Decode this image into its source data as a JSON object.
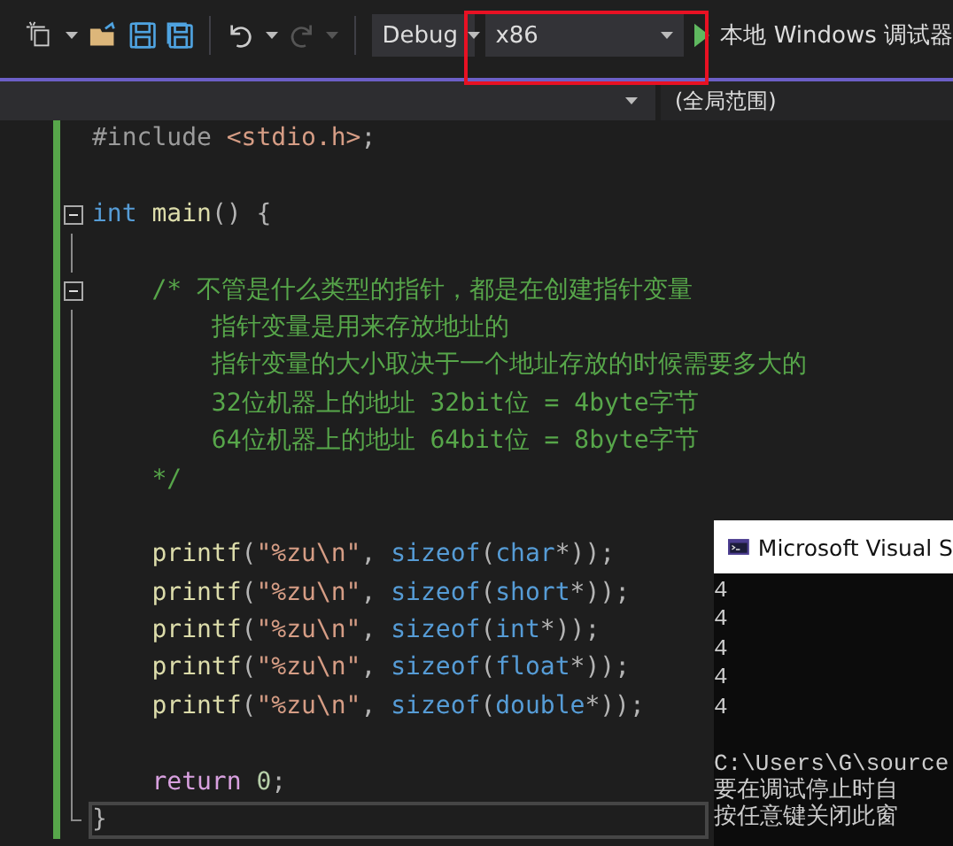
{
  "toolbar": {
    "redo_disabled": true,
    "configuration": "Debug",
    "platform": "x86",
    "platform_highlighted": true,
    "run_label": "本地 Windows 调试器"
  },
  "navigation_bar": {
    "scope": "(全局范围)"
  },
  "editor": {
    "lines": [
      {
        "current": false,
        "tokens": [
          {
            "kind": "preprocessor",
            "text": "#include "
          },
          {
            "kind": "string",
            "text": "<stdio.h>"
          },
          {
            "kind": "punct",
            "text": ";"
          }
        ]
      },
      {
        "current": false
      },
      {
        "current": false,
        "kind": "fold-start",
        "tokens": [
          {
            "kind": "keyword",
            "text": "int"
          },
          {
            "kind": "function",
            "text": " main"
          },
          {
            "kind": "punct",
            "text": "() {"
          }
        ]
      },
      {
        "current": false,
        "kind": "fold-inner"
      },
      {
        "current": false,
        "kind": "fold-start",
        "tokens": [
          {
            "kind": "comment",
            "text": "    /* 不管是什么类型的指针，都是在创建指针变量"
          }
        ]
      },
      {
        "current": false,
        "kind": "fold-inner",
        "tokens": [
          {
            "kind": "comment",
            "text": "        指针变量是用来存放地址的"
          }
        ]
      },
      {
        "current": false,
        "kind": "fold-inner",
        "tokens": [
          {
            "kind": "comment",
            "text": "        指针变量的大小取决于一个地址存放的时候需要多大的"
          }
        ]
      },
      {
        "current": false,
        "kind": "fold-inner",
        "tokens": [
          {
            "kind": "comment",
            "text": "        32位机器上的地址 32bit位 = 4byte字节"
          }
        ]
      },
      {
        "current": false,
        "kind": "fold-inner",
        "tokens": [
          {
            "kind": "comment",
            "text": "        64位机器上的地址 64bit位 = 8byte字节"
          }
        ]
      },
      {
        "current": false,
        "kind": "fold-inner",
        "tokens": [
          {
            "kind": "comment",
            "text": "    */"
          }
        ]
      },
      {
        "current": false,
        "kind": "fold-inner"
      },
      {
        "current": false,
        "kind": "fold-inner",
        "tokens": [
          {
            "kind": "function",
            "text": "    printf"
          },
          {
            "kind": "punct",
            "text": "("
          },
          {
            "kind": "string",
            "text": "\"%zu\\n\""
          },
          {
            "kind": "punct",
            "text": ", "
          },
          {
            "kind": "keyword",
            "text": "sizeof"
          },
          {
            "kind": "punct",
            "text": "("
          },
          {
            "kind": "keyword",
            "text": "char"
          },
          {
            "kind": "punct",
            "text": "*));"
          }
        ]
      },
      {
        "current": false,
        "kind": "fold-inner",
        "tokens": [
          {
            "kind": "function",
            "text": "    printf"
          },
          {
            "kind": "punct",
            "text": "("
          },
          {
            "kind": "string",
            "text": "\"%zu\\n\""
          },
          {
            "kind": "punct",
            "text": ", "
          },
          {
            "kind": "keyword",
            "text": "sizeof"
          },
          {
            "kind": "punct",
            "text": "("
          },
          {
            "kind": "keyword",
            "text": "short"
          },
          {
            "kind": "punct",
            "text": "*));"
          }
        ]
      },
      {
        "current": false,
        "kind": "fold-inner",
        "tokens": [
          {
            "kind": "function",
            "text": "    printf"
          },
          {
            "kind": "punct",
            "text": "("
          },
          {
            "kind": "string",
            "text": "\"%zu\\n\""
          },
          {
            "kind": "punct",
            "text": ", "
          },
          {
            "kind": "keyword",
            "text": "sizeof"
          },
          {
            "kind": "punct",
            "text": "("
          },
          {
            "kind": "keyword",
            "text": "int"
          },
          {
            "kind": "punct",
            "text": "*));"
          }
        ]
      },
      {
        "current": false,
        "kind": "fold-inner",
        "tokens": [
          {
            "kind": "function",
            "text": "    printf"
          },
          {
            "kind": "punct",
            "text": "("
          },
          {
            "kind": "string",
            "text": "\"%zu\\n\""
          },
          {
            "kind": "punct",
            "text": ", "
          },
          {
            "kind": "keyword",
            "text": "sizeof"
          },
          {
            "kind": "punct",
            "text": "("
          },
          {
            "kind": "keyword",
            "text": "float"
          },
          {
            "kind": "punct",
            "text": "*));"
          }
        ]
      },
      {
        "current": false,
        "kind": "fold-inner",
        "tokens": [
          {
            "kind": "function",
            "text": "    printf"
          },
          {
            "kind": "punct",
            "text": "("
          },
          {
            "kind": "string",
            "text": "\"%zu\\n\""
          },
          {
            "kind": "punct",
            "text": ", "
          },
          {
            "kind": "keyword",
            "text": "sizeof"
          },
          {
            "kind": "punct",
            "text": "("
          },
          {
            "kind": "keyword",
            "text": "double"
          },
          {
            "kind": "punct",
            "text": "*));"
          }
        ]
      },
      {
        "current": false,
        "kind": "fold-inner"
      },
      {
        "current": false,
        "kind": "fold-inner",
        "tokens": [
          {
            "kind": "control",
            "text": "    return "
          },
          {
            "kind": "number",
            "text": "0"
          },
          {
            "kind": "punct",
            "text": ";"
          }
        ]
      },
      {
        "current": true,
        "kind": "fold-end",
        "tokens": [
          {
            "kind": "punct",
            "text": "}"
          }
        ]
      }
    ]
  },
  "console": {
    "title": "Microsoft Visual S",
    "output": [
      "4",
      "4",
      "4",
      "4",
      "4"
    ],
    "messages": [
      "C:\\Users\\G\\source",
      "要在调试停止时自",
      "按任意键关闭此窗"
    ]
  }
}
